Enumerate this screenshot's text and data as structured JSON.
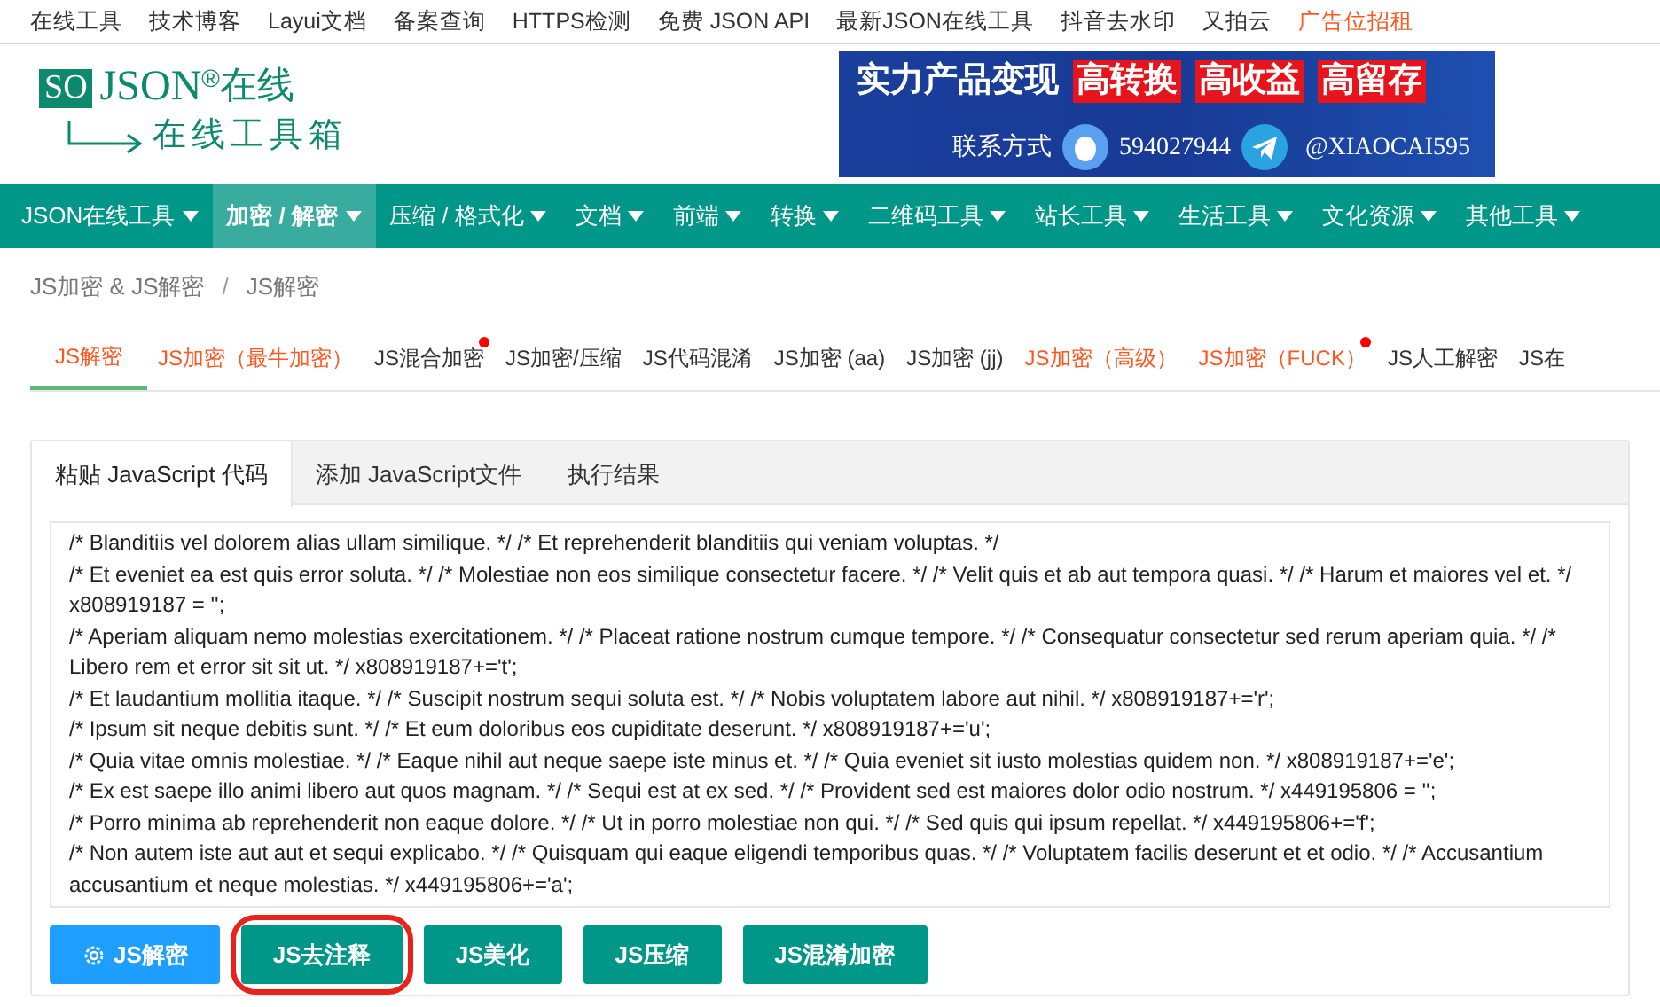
{
  "top_links": [
    {
      "label": "在线工具",
      "kind": "normal"
    },
    {
      "label": "技术博客",
      "kind": "normal"
    },
    {
      "label": "Layui文档",
      "kind": "normal"
    },
    {
      "label": "备案查询",
      "kind": "normal"
    },
    {
      "label": "HTTPS检测",
      "kind": "normal"
    },
    {
      "label": "免费 JSON API",
      "kind": "normal"
    },
    {
      "label": "最新JSON在线工具",
      "kind": "normal"
    },
    {
      "label": "抖音去水印",
      "kind": "normal"
    },
    {
      "label": "又拍云",
      "kind": "normal"
    },
    {
      "label": "广告位招租",
      "kind": "ad"
    }
  ],
  "logo": {
    "badge": "SO",
    "name": "JSON",
    "mark": "®",
    "suffix": "在线",
    "tagline": "在线工具箱"
  },
  "banner": {
    "headline": "实力产品变现",
    "tags": [
      "高转换",
      "高收益",
      "高留存"
    ],
    "contact_label": "联系方式",
    "qq": "594027944",
    "telegram": "@XIAOCAI595"
  },
  "nav": [
    {
      "label": "JSON在线工具",
      "selected": false
    },
    {
      "label": "加密 / 解密",
      "selected": true
    },
    {
      "label": "压缩 / 格式化",
      "selected": false
    },
    {
      "label": "文档",
      "selected": false
    },
    {
      "label": "前端",
      "selected": false
    },
    {
      "label": "转换",
      "selected": false
    },
    {
      "label": "二维码工具",
      "selected": false
    },
    {
      "label": "站长工具",
      "selected": false
    },
    {
      "label": "生活工具",
      "selected": false
    },
    {
      "label": "文化资源",
      "selected": false
    },
    {
      "label": "其他工具",
      "selected": false
    }
  ],
  "breadcrumb": [
    "JS加密 & JS解密",
    "JS解密"
  ],
  "breadcrumb_separator": "/",
  "tool_tabs": [
    {
      "label": "JS解密",
      "selected": true,
      "hot": false,
      "new": false
    },
    {
      "label": "JS加密（最牛加密）",
      "selected": false,
      "hot": true,
      "new": false
    },
    {
      "label": "JS混合加密",
      "selected": false,
      "hot": false,
      "new": true
    },
    {
      "label": "JS加密/压缩",
      "selected": false,
      "hot": false,
      "new": false
    },
    {
      "label": "JS代码混淆",
      "selected": false,
      "hot": false,
      "new": false
    },
    {
      "label": "JS加密 (aa)",
      "selected": false,
      "hot": false,
      "new": false
    },
    {
      "label": "JS加密 (jj)",
      "selected": false,
      "hot": false,
      "new": false
    },
    {
      "label": "JS加密（高级）",
      "selected": false,
      "hot": true,
      "new": false
    },
    {
      "label": "JS加密（FUCK）",
      "selected": false,
      "hot": true,
      "new": true
    },
    {
      "label": "JS人工解密",
      "selected": false,
      "hot": false,
      "new": false
    },
    {
      "label": "JS在",
      "selected": false,
      "hot": false,
      "new": false
    }
  ],
  "panel_tabs": [
    {
      "label": "粘贴 JavaScript 代码",
      "selected": true
    },
    {
      "label": "添加 JavaScript文件",
      "selected": false
    },
    {
      "label": "执行结果",
      "selected": false
    }
  ],
  "code_lines": [
    "/* Blanditiis vel dolorem alias ullam similique. */ /* Et reprehenderit blanditiis qui veniam voluptas. */",
    "/* Et eveniet ea est quis error soluta. */ /* Molestiae non eos similique consectetur facere. */ /* Velit quis et ab aut tempora quasi. */ /* Harum et maiores vel et. */                x808919187 = '';",
    "/* Aperiam aliquam nemo molestias exercitationem. */ /* Placeat ratione nostrum cumque tempore. */ /* Consequatur consectetur sed rerum aperiam quia. */ /* Libero rem et error sit sit ut. */ x808919187+='t';",
    "/* Et laudantium mollitia itaque. */ /* Suscipit nostrum sequi soluta est. */ /* Nobis voluptatem labore aut nihil. */ x808919187+='r';",
    "/* Ipsum sit neque debitis sunt. */ /* Et eum doloribus eos cupiditate deserunt. */ x808919187+='u';",
    "/* Quia vitae omnis molestiae. */ /* Eaque nihil aut neque saepe iste minus et. */ /* Quia eveniet sit iusto molestias quidem non. */ x808919187+='e';",
    "/* Ex est saepe illo animi libero aut quos magnam. */ /* Sequi est at ex sed. */ /* Provident sed est maiores dolor odio nostrum. */ x449195806 = '';",
    "/* Porro minima ab reprehenderit non eaque dolore. */ /* Ut in porro molestiae non qui. */ /* Sed quis qui ipsum repellat. */ x449195806+='f';",
    "/* Non autem iste aut aut et sequi explicabo. */ /* Quisquam qui eaque eligendi temporibus quas. */ /* Voluptatem facilis deserunt et et odio. */ /* Accusantium accusantium et neque molestias. */ x449195806+='a';"
  ],
  "actions": [
    {
      "label": "JS解密",
      "kind": "primary",
      "highlighted": false
    },
    {
      "label": "JS去注释",
      "kind": "normal",
      "highlighted": true
    },
    {
      "label": "JS美化",
      "kind": "normal",
      "highlighted": false
    },
    {
      "label": "JS压缩",
      "kind": "normal",
      "highlighted": false
    },
    {
      "label": "JS混淆加密",
      "kind": "normal",
      "highlighted": false
    }
  ]
}
